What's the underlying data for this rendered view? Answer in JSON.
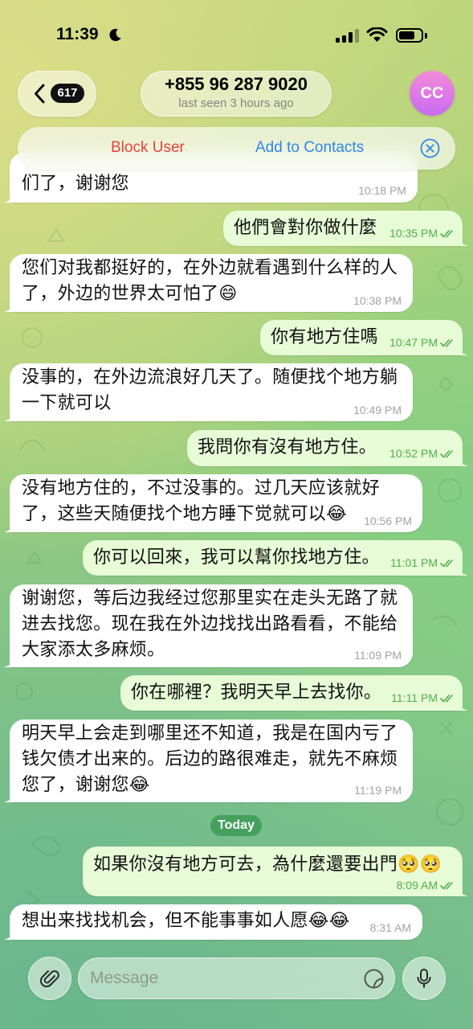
{
  "status_bar": {
    "time": "11:39",
    "moon_icon": "moon-icon",
    "signal_strength": 3,
    "signal_max": 4,
    "wifi_icon": "wifi-icon",
    "battery_level": 0.72
  },
  "header": {
    "back_icon": "chevron-left-icon",
    "unread_badge": "617",
    "title": "+855 96 287 9020",
    "subtitle": "last seen 3 hours ago",
    "avatar_initials": "CC",
    "avatar_gradient": [
      "#f48bd7",
      "#c86cf2"
    ]
  },
  "action_bar": {
    "block_label": "Block User",
    "add_contact_label": "Add to Contacts",
    "close_icon": "close-circle-icon"
  },
  "messages": [
    {
      "outgoing": false,
      "lines": [
        "们了，谢谢您"
      ],
      "time": "10:18 PM"
    },
    {
      "outgoing": true,
      "lines": [
        "他們會對你做什麼"
      ],
      "time": "10:35 PM",
      "status_icon": "double-check-icon"
    },
    {
      "outgoing": false,
      "lines": [
        "您们对我都挺好的，在外边就看遇到什么样的人",
        "了，外边的世界太可怕了😄"
      ],
      "time": "10:38 PM"
    },
    {
      "outgoing": true,
      "lines": [
        "你有地方住嗎"
      ],
      "time": "10:47 PM",
      "status_icon": "double-check-icon"
    },
    {
      "outgoing": false,
      "lines": [
        "没事的，在外边流浪好几天了。随便找个地方躺",
        "一下就可以"
      ],
      "time": "10:49 PM"
    },
    {
      "outgoing": true,
      "lines": [
        "我問你有沒有地方住。"
      ],
      "time": "10:52 PM",
      "status_icon": "double-check-icon"
    },
    {
      "outgoing": false,
      "lines": [
        "没有地方住的，不过没事的。过几天应该就好",
        "了，这些天随便找个地方睡下觉就可以😂"
      ],
      "time": "10:56 PM"
    },
    {
      "outgoing": true,
      "lines": [
        "你可以回來，我可以幫你找地方住。"
      ],
      "time": "11:01 PM",
      "status_icon": "double-check-icon"
    },
    {
      "outgoing": false,
      "lines": [
        "谢谢您，等后边我经过您那里实在走头无路了就",
        "进去找您。现在我在外边找找出路看看，不能给",
        "大家添太多麻烦。"
      ],
      "time": "11:09 PM"
    },
    {
      "outgoing": true,
      "lines": [
        "你在哪裡？我明天早上去找你。"
      ],
      "time": "11:11 PM",
      "status_icon": "double-check-icon"
    },
    {
      "outgoing": false,
      "lines": [
        "明天早上会走到哪里还不知道，我是在国内亏了",
        "钱欠债才出来的。后边的路很难走，就先不麻烦",
        "您了，谢谢您😂"
      ],
      "time": "11:19 PM"
    },
    {
      "outgoing": true,
      "lines": [
        "如果你沒有地方可去，為什麼還要出門🥺🥺"
      ],
      "time": "8:09 AM",
      "status_icon": "double-check-icon"
    },
    {
      "outgoing": false,
      "lines": [
        "想出来找找机会，但不能事事如人愿😂😂"
      ],
      "time": "8:31 AM"
    }
  ],
  "date_separator": {
    "label": "Today"
  },
  "input_bar": {
    "attach_icon": "paperclip-icon",
    "placeholder": "Message",
    "sticker_icon": "sticker-icon",
    "mic_icon": "microphone-icon"
  },
  "colors": {
    "incoming_bubble": "#ffffff",
    "outgoing_bubble": "#e7fbd6",
    "outgoing_time": "#4fae4e",
    "incoming_time": "#a3a3a3",
    "block": "#e5413a",
    "link": "#2f86e8",
    "date_pill": "#45a05d"
  }
}
